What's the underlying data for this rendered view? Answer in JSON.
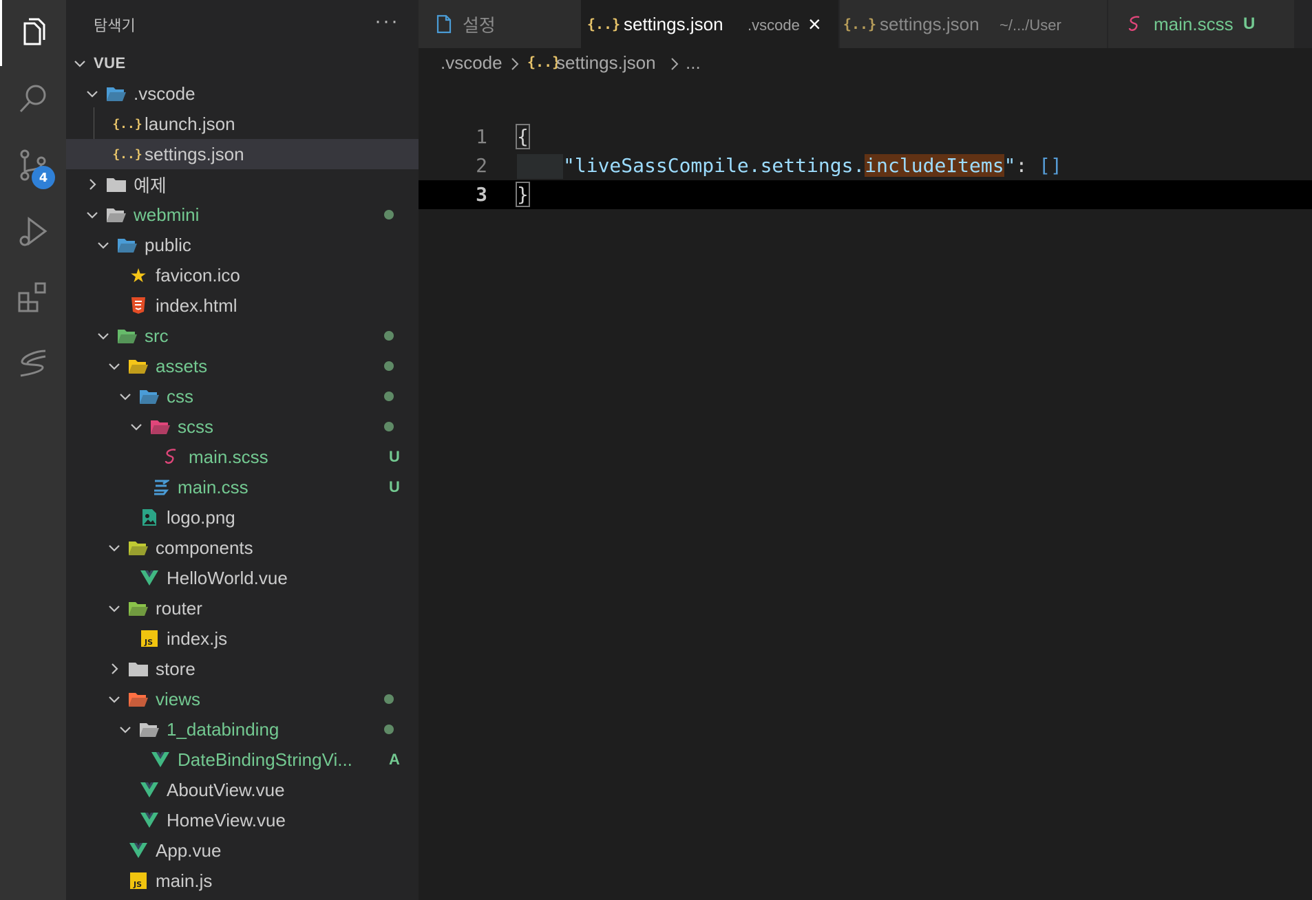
{
  "activity_bar": {
    "items": [
      {
        "name": "explorer",
        "icon": "files-icon",
        "active": true
      },
      {
        "name": "search",
        "icon": "search-icon"
      },
      {
        "name": "source-control",
        "icon": "source-control-icon",
        "badge": "4"
      },
      {
        "name": "run-debug",
        "icon": "run-debug-icon"
      },
      {
        "name": "extensions",
        "icon": "extensions-icon"
      },
      {
        "name": "sass",
        "icon": "sass-icon"
      }
    ]
  },
  "sidebar": {
    "title": "탐색기",
    "more": "···",
    "root": "VUE",
    "tree": [
      {
        "label": ".vscode",
        "depth": 1,
        "type": "folder-open",
        "icon": "vscode-folder-icon"
      },
      {
        "label": "launch.json",
        "depth": 2,
        "type": "file",
        "icon": "json-icon"
      },
      {
        "label": "settings.json",
        "depth": 2,
        "type": "file",
        "icon": "json-icon",
        "selected": true
      },
      {
        "label": "예제",
        "depth": 1,
        "type": "folder-closed",
        "icon": "folder-icon"
      },
      {
        "label": "webmini",
        "depth": 1,
        "type": "folder-open",
        "icon": "folder-open-icon",
        "status": "modified-dot"
      },
      {
        "label": "public",
        "depth": 2,
        "type": "folder-open",
        "icon": "public-folder-icon"
      },
      {
        "label": "favicon.ico",
        "depth": 3,
        "type": "file",
        "icon": "star-icon"
      },
      {
        "label": "index.html",
        "depth": 3,
        "type": "file",
        "icon": "html5-icon"
      },
      {
        "label": "src",
        "depth": 2,
        "type": "folder-open",
        "icon": "src-folder-icon",
        "status": "modified-dot"
      },
      {
        "label": "assets",
        "depth": 3,
        "type": "folder-open",
        "icon": "assets-folder-icon",
        "status": "modified-dot"
      },
      {
        "label": "css",
        "depth": 4,
        "type": "folder-open",
        "icon": "css-folder-icon",
        "status": "modified-dot"
      },
      {
        "label": "scss",
        "depth": 5,
        "type": "folder-open",
        "icon": "scss-folder-icon",
        "status": "modified-dot"
      },
      {
        "label": "main.scss",
        "depth": 6,
        "type": "file",
        "icon": "sass-file-icon",
        "status": "U"
      },
      {
        "label": "main.css",
        "depth": 5,
        "type": "file",
        "icon": "css3-icon",
        "status": "U"
      },
      {
        "label": "logo.png",
        "depth": 4,
        "type": "file",
        "icon": "image-icon"
      },
      {
        "label": "components",
        "depth": 3,
        "type": "folder-open",
        "icon": "components-folder-icon"
      },
      {
        "label": "HelloWorld.vue",
        "depth": 4,
        "type": "file",
        "icon": "vue-icon"
      },
      {
        "label": "router",
        "depth": 3,
        "type": "folder-open",
        "icon": "router-folder-icon"
      },
      {
        "label": "index.js",
        "depth": 4,
        "type": "file",
        "icon": "js-icon"
      },
      {
        "label": "store",
        "depth": 3,
        "type": "folder-closed",
        "icon": "folder-icon"
      },
      {
        "label": "views",
        "depth": 3,
        "type": "folder-open",
        "icon": "views-folder-icon",
        "status": "modified-dot"
      },
      {
        "label": "1_databinding",
        "depth": 4,
        "type": "folder-open",
        "icon": "folder-open-icon",
        "status": "modified-dot"
      },
      {
        "label": "DateBindingStringVi...",
        "depth": 5,
        "type": "file",
        "icon": "vue-icon",
        "status": "A"
      },
      {
        "label": "AboutView.vue",
        "depth": 4,
        "type": "file",
        "icon": "vue-icon"
      },
      {
        "label": "HomeView.vue",
        "depth": 4,
        "type": "file",
        "icon": "vue-icon"
      },
      {
        "label": "App.vue",
        "depth": 3,
        "type": "file",
        "icon": "vue-icon"
      },
      {
        "label": "main.js",
        "depth": 3,
        "type": "file",
        "icon": "js-icon"
      }
    ]
  },
  "tabs": [
    {
      "label": "설정",
      "icon": "settings-file-icon",
      "description": ""
    },
    {
      "label": "settings.json",
      "icon": "json-icon",
      "description": ".vscode",
      "active": true,
      "close": "×"
    },
    {
      "label": "settings.json",
      "icon": "json-icon",
      "description": "~/.../User"
    },
    {
      "label": "main.scss",
      "icon": "sass-file-icon",
      "description": "U"
    }
  ],
  "breadcrumb": [
    ".vscode",
    "settings.json",
    "..."
  ],
  "editor": {
    "lines": [
      {
        "number": "1",
        "text": "{"
      },
      {
        "number": "2",
        "key_prefix": "\"liveSassCompile.settings.",
        "key_highlight": "includeItems",
        "key_suffix": "\"",
        "colon": ":",
        "value": "[]"
      },
      {
        "number": "3",
        "text": "}"
      }
    ]
  },
  "colors": {
    "accent": "#2f80d7",
    "untracked": "#73c991",
    "modified_dot": "#5f8a66",
    "json": "#e8c46a",
    "vue": "#41b883",
    "sass": "#e0467a",
    "css": "#4a9cd6"
  }
}
